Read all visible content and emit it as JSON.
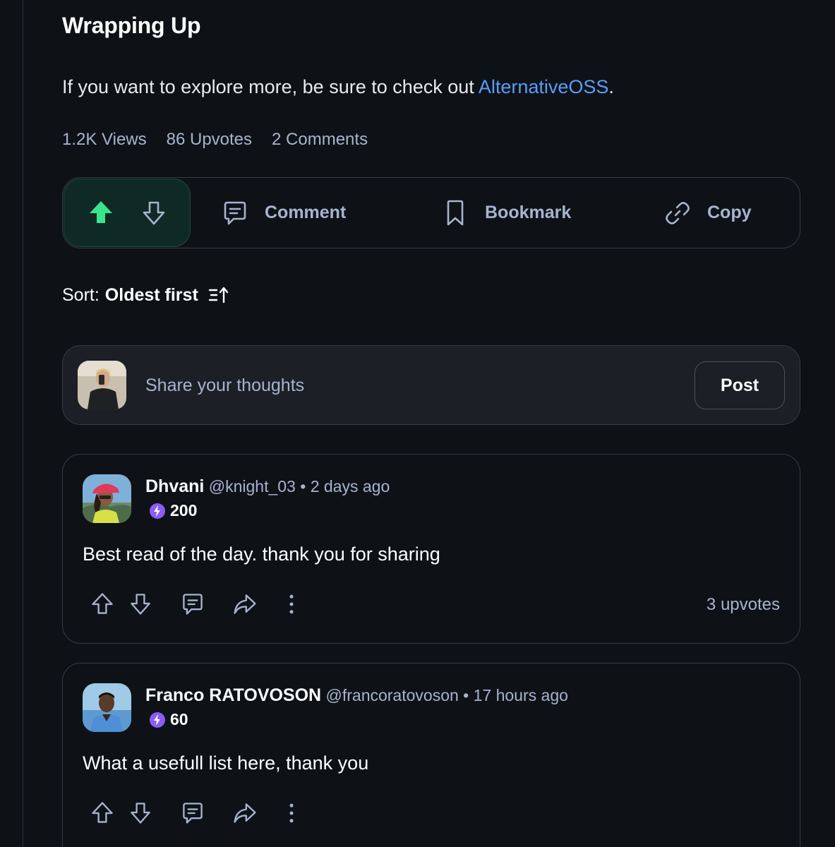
{
  "article": {
    "heading": "Wrapping Up",
    "paragraph_before": "If you want to explore more, be sure to check out ",
    "link_text": "AlternativeOSS",
    "paragraph_after": "."
  },
  "stats": {
    "views": "1.2K Views",
    "upvotes": "86 Upvotes",
    "comments": "2 Comments"
  },
  "action_bar": {
    "upvote_state": "active",
    "accent_color": "#39e58c",
    "comment_label": "Comment",
    "bookmark_label": "Bookmark",
    "copy_label": "Copy"
  },
  "sort": {
    "label": "Sort:",
    "value": "Oldest first"
  },
  "composer": {
    "placeholder": "Share your thoughts",
    "post_label": "Post"
  },
  "comments": [
    {
      "name": "Dhvani",
      "handle": "@knight_03",
      "separator": "•",
      "time": "2 days ago",
      "reputation": "200",
      "text": "Best read of the day. thank you for sharing",
      "upvotes": "3 upvotes"
    },
    {
      "name": "Franco RATOVOSON",
      "handle": "@francoratovoson",
      "separator": "•",
      "time": "17 hours ago",
      "reputation": "60",
      "text": "What a usefull list here, thank you",
      "upvotes": ""
    }
  ],
  "colors": {
    "background": "#0e1217",
    "muted_text": "#a8b3cf",
    "link": "#5b9cf7",
    "reputation_bolt": "#8b5cf6",
    "border": "#353b45"
  }
}
